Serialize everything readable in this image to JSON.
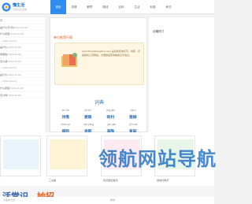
{
  "site": {
    "brand": "懂生活",
    "tagline": "百科生活小知识"
  },
  "nav": [
    "首页",
    "词典",
    "解梦",
    "路线",
    "百科",
    "生活",
    "科普",
    "养花"
  ],
  "left_list": [
    {
      "title": "字…",
      "date": ""
    },
    {
      "title": "是什么字(词)",
      "date": "(2024-09-03)"
    },
    {
      "title": "什么意思",
      "date": "(2024-09-03)"
    },
    {
      "title": "…",
      "date": "(2024-09-03)"
    },
    {
      "title": "是什么",
      "date": "(2024-09-03)"
    },
    {
      "title": "有哪些",
      "date": "(2024-09-03)"
    },
    {
      "title": "怎么读",
      "date": "(2024-09-03)"
    },
    {
      "title": "…",
      "date": "(2024-09-03)"
    },
    {
      "title": "是什么",
      "date": "(2024-09-03)"
    },
    {
      "title": "…",
      "date": "(2024-09-03)"
    },
    {
      "title": "什么意思",
      "date": "(2024-09-03)"
    },
    {
      "title": "怎么样",
      "date": "(2024-09-03)"
    }
  ],
  "hero": {
    "head": "单位推荐行情",
    "text": "(www.DongShengHuo.com) 是在线查询汉字、拼音、词语等的工具网站，方便快速查询各类汉字信息。",
    "dict_title": "词典",
    "rows": [
      {
        "pinyin": [
          "shī xiě",
          "jiē shī",
          "jǐng jiàn",
          "yǎo lì"
        ],
        "words": [
          "诗笺",
          "婆路",
          "刺利",
          "楚楠"
        ]
      },
      {
        "pinyin": [
          "shàn ya",
          "hàn jiàng",
          "jiàn jiǎo",
          "jiē kuài"
        ],
        "words": [
          "搽阻",
          "诡筋",
          "溪陶",
          "鲨鼓"
        ]
      }
    ]
  },
  "right": {
    "head": "近期热门"
  },
  "cards": [
    {
      "caption": "…",
      "color": "#eaf4fb"
    },
    {
      "caption": "三文鱼",
      "color": "#fff3d6"
    },
    {
      "caption": "有道里的首码",
      "color": "#fbeaf1"
    },
    {
      "caption": "煤岗托教手",
      "color": "#e8f6ea"
    }
  ],
  "banner": {
    "prefix": "活",
    "part1": "常识、",
    "part2": "妙招"
  },
  "watermark": "领航网站导航",
  "bottom": {
    "left": "大鱼吃方法",
    "right": "教你…"
  }
}
